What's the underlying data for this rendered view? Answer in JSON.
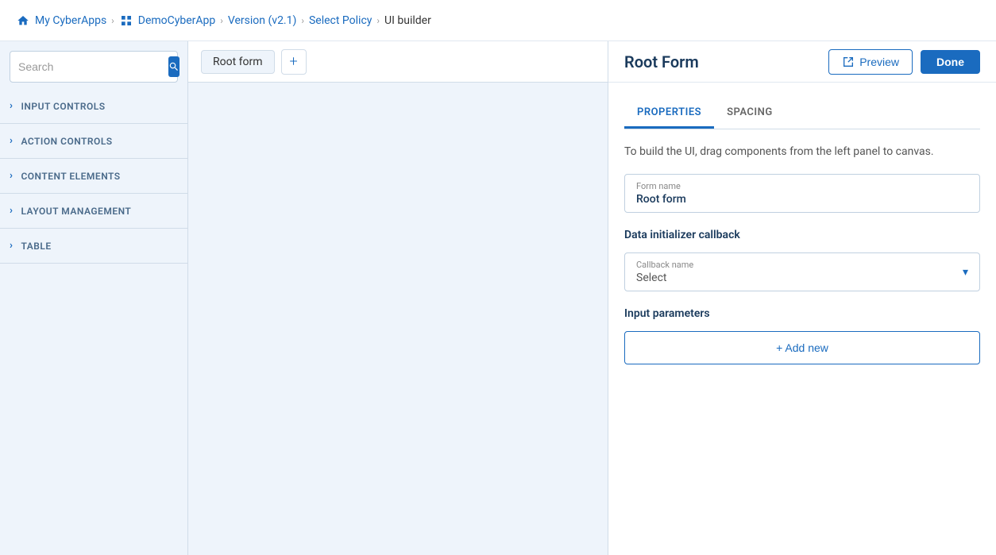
{
  "breadcrumb": {
    "items": [
      {
        "label": "My CyberApps",
        "icon": "home-icon"
      },
      {
        "label": "DemoCyberApp",
        "icon": "apps-icon"
      },
      {
        "label": "Version (v2.1)",
        "icon": null
      },
      {
        "label": "Select Policy",
        "icon": null
      },
      {
        "label": "UI builder",
        "icon": null
      }
    ]
  },
  "search": {
    "placeholder": "Search"
  },
  "sidebar": {
    "sections": [
      {
        "label": "INPUT CONTROLS"
      },
      {
        "label": "ACTION CONTROLS"
      },
      {
        "label": "CONTENT ELEMENTS"
      },
      {
        "label": "LAYOUT MANAGEMENT"
      },
      {
        "label": "TABLE"
      }
    ]
  },
  "canvas": {
    "tab_label": "Root form",
    "add_tooltip": "Add"
  },
  "header": {
    "preview_label": "Preview",
    "done_label": "Done"
  },
  "right_panel": {
    "title": "Root Form",
    "tabs": [
      {
        "label": "PROPERTIES"
      },
      {
        "label": "SPACING"
      }
    ],
    "hint": "To build the UI, drag components from the left panel to canvas.",
    "form_name_label": "Form name",
    "form_name_value": "Root form",
    "data_initializer_label": "Data initializer callback",
    "callback_name_label": "Callback name",
    "callback_placeholder": "Select",
    "input_params_label": "Input parameters",
    "add_new_label": "+ Add new"
  }
}
